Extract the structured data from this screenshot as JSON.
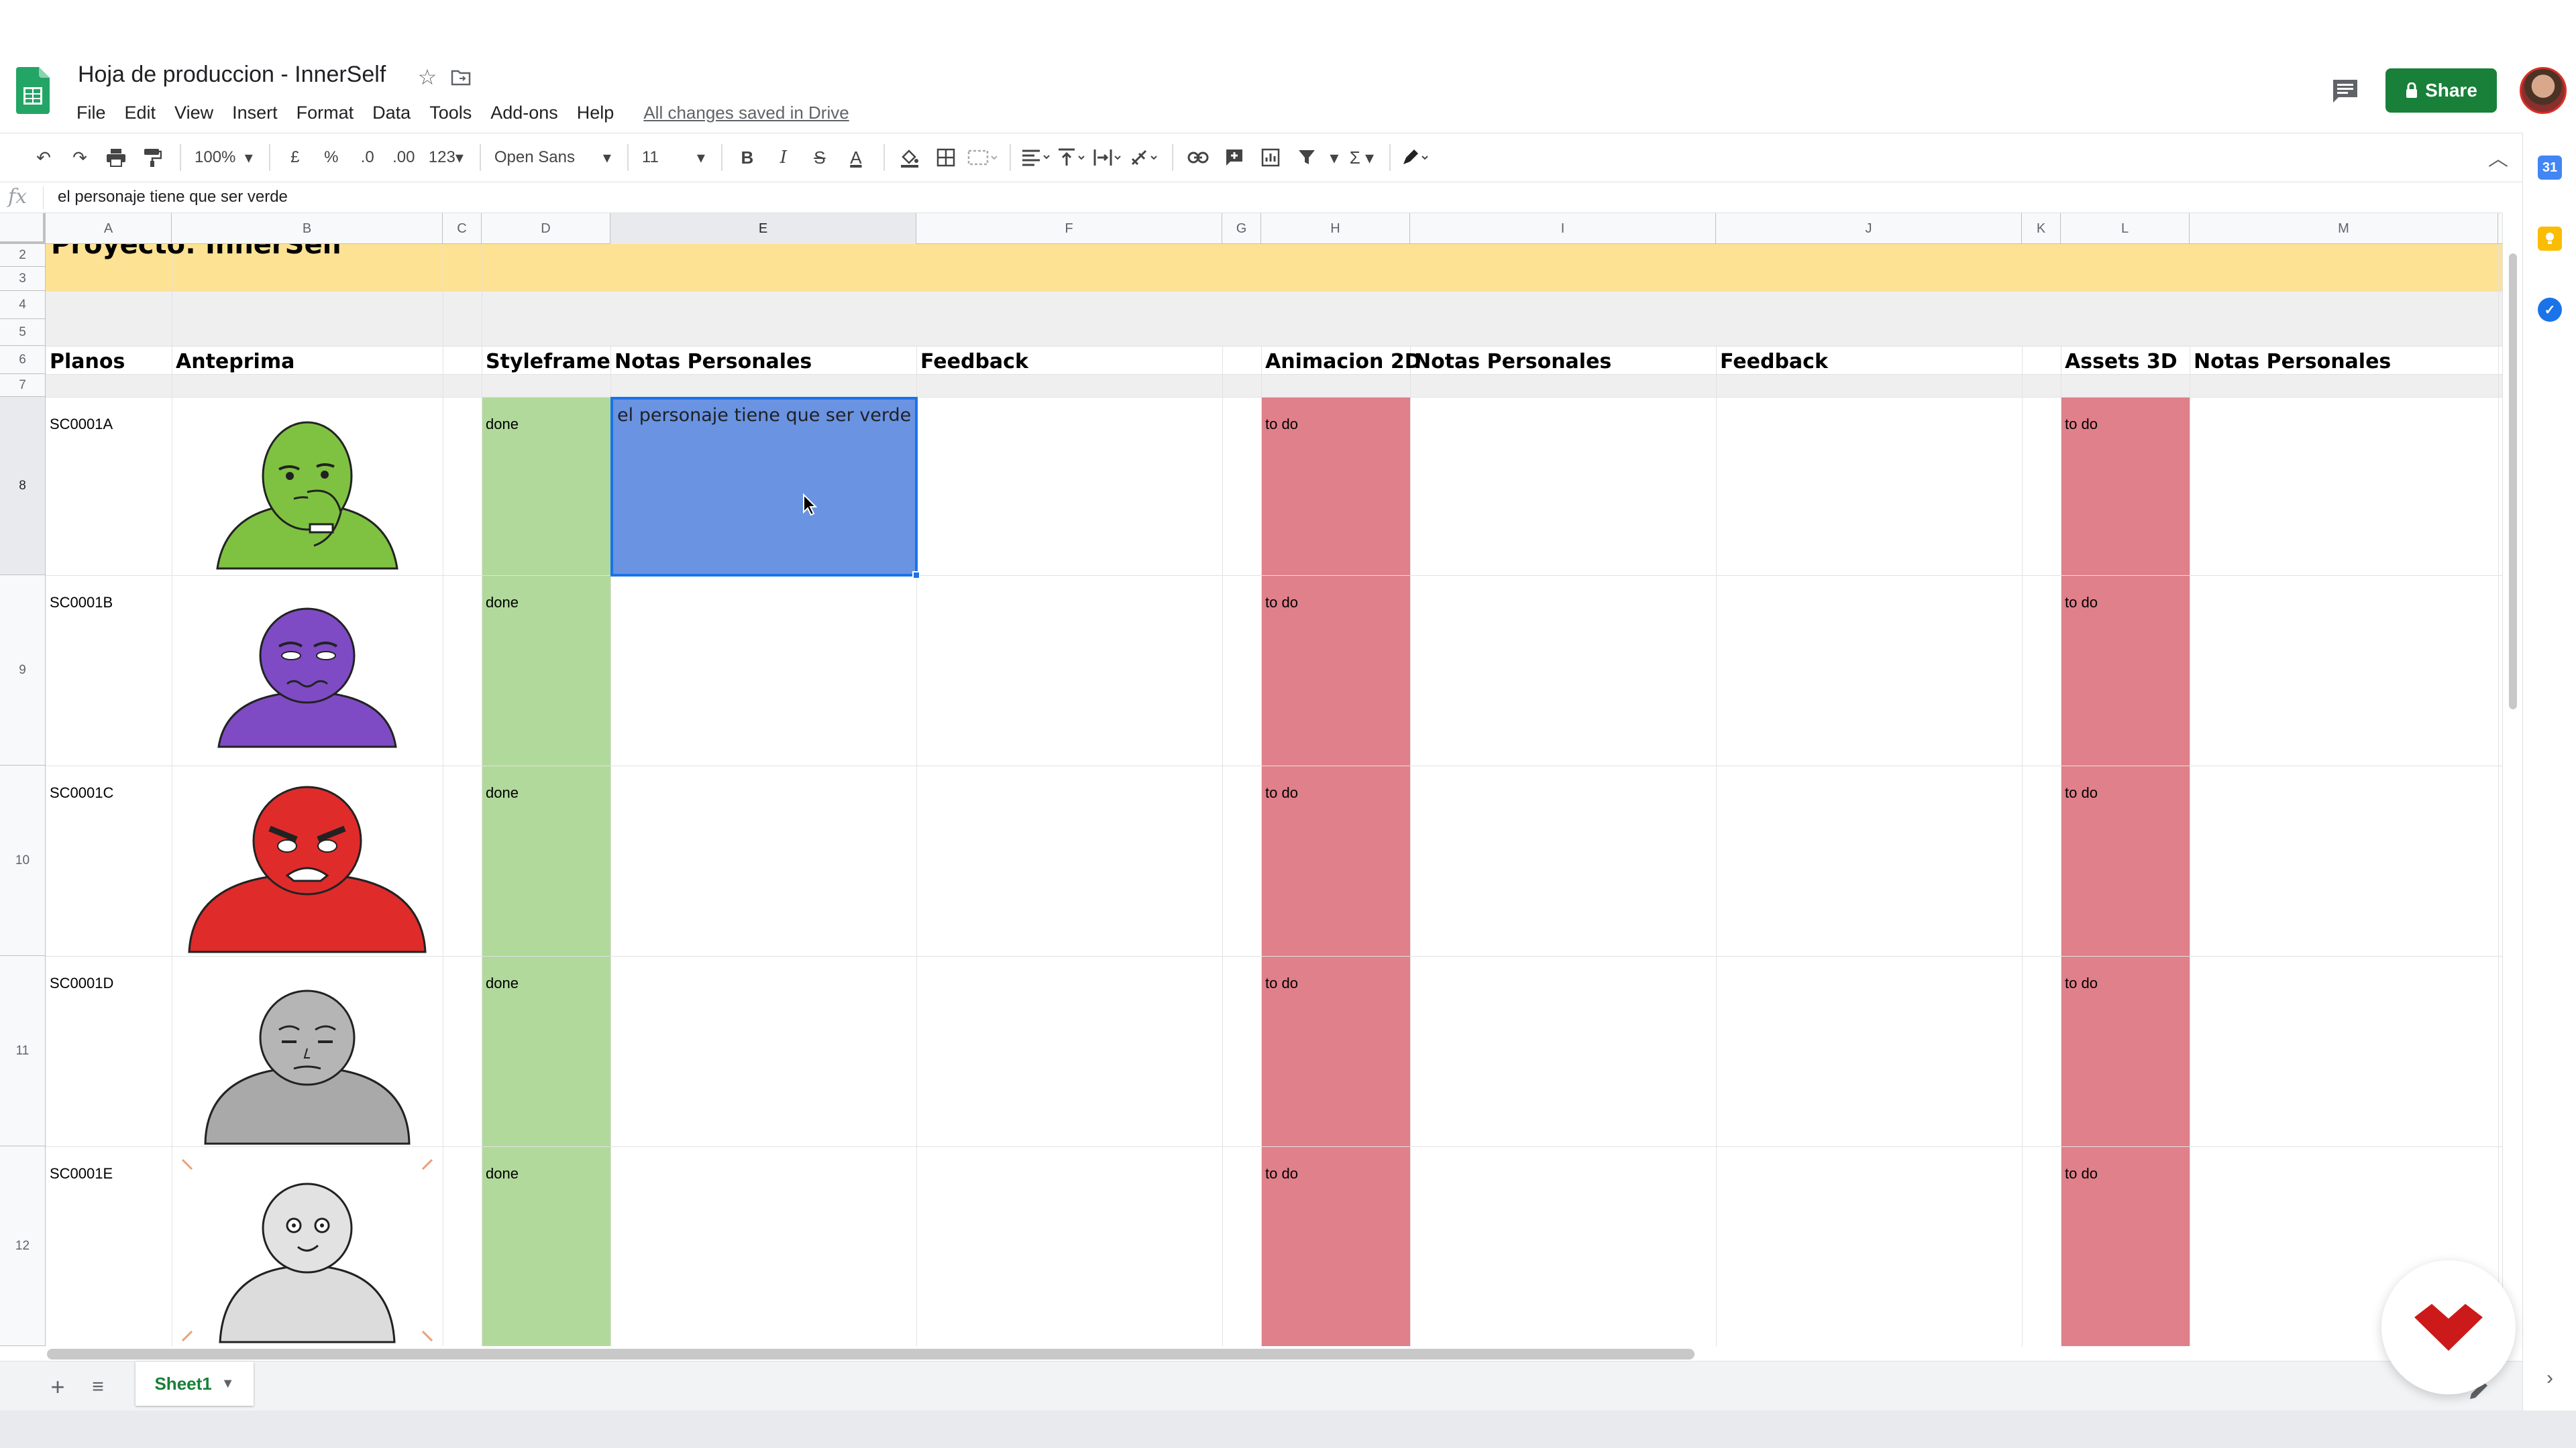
{
  "app": {
    "doc_title": "Hoja de produccion - InnerSelf",
    "save_status": "All changes saved in Drive",
    "share_label": "Share"
  },
  "menu": [
    "File",
    "Edit",
    "View",
    "Insert",
    "Format",
    "Data",
    "Tools",
    "Add-ons",
    "Help"
  ],
  "toolbar": {
    "zoom": "100%",
    "currency": "£",
    "percent": "%",
    "decrease_decimals": ".0",
    "increase_decimals": ".00",
    "more_formats": "123",
    "font_family": "Open Sans",
    "font_size": "11",
    "bold": "B",
    "italic": "I",
    "strike": "S",
    "text_color": "A",
    "sum": "Σ"
  },
  "formula_bar": {
    "fx_label": "fx",
    "value": "el personaje tiene que ser verde"
  },
  "columns": [
    "A",
    "B",
    "C",
    "D",
    "E",
    "F",
    "G",
    "H",
    "I",
    "J",
    "K",
    "L",
    "M"
  ],
  "rows": [
    "2",
    "3",
    "4",
    "5",
    "6",
    "7",
    "8",
    "9",
    "10",
    "11",
    "12"
  ],
  "project_title": "Proyecto: InnerSelf",
  "headers": {
    "planos": "Planos",
    "anteprima": "Anteprima",
    "styleframe": "Styleframe",
    "notas1": "Notas Personales",
    "feedback1": "Feedback",
    "anim2d": "Animacion 2D",
    "notas2": "Notas Personales",
    "feedback2": "Feedback",
    "assets3d": "Assets 3D",
    "notas3": "Notas Personales"
  },
  "shots": [
    {
      "id": "SC0001A",
      "styleframe": "done",
      "notas": "el personaje tiene que ser verde",
      "anim2d": "to do",
      "assets3d": "to do",
      "color": "#7fc241"
    },
    {
      "id": "SC0001B",
      "styleframe": "done",
      "notas": "",
      "anim2d": "to do",
      "assets3d": "to do",
      "color": "#7e4bc4"
    },
    {
      "id": "SC0001C",
      "styleframe": "done",
      "notas": "",
      "anim2d": "to do",
      "assets3d": "to do",
      "color": "#e02b2b"
    },
    {
      "id": "SC0001D",
      "styleframe": "done",
      "notas": "",
      "anim2d": "to do",
      "assets3d": "to do",
      "color": "#a9a9a9"
    },
    {
      "id": "SC0001E",
      "styleframe": "done",
      "notas": "",
      "anim2d": "to do",
      "assets3d": "to do",
      "color": "#d4d4d4"
    }
  ],
  "sheets": {
    "active": "Sheet1"
  },
  "colors": {
    "header_band": "#fde293",
    "done": "#b0d99b",
    "todo": "#e0808a",
    "selection": "#6a93e2",
    "accent_green": "#188038"
  }
}
